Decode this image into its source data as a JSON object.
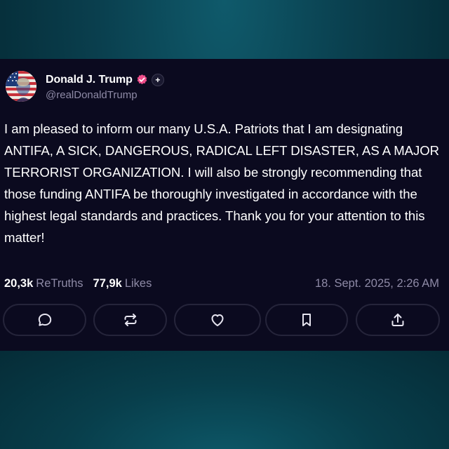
{
  "post": {
    "author": {
      "display_name": "Donald J. Trump",
      "handle": "@realDonaldTrump",
      "plus_label": "+"
    },
    "text": "I am pleased to inform our many U.S.A. Patriots that I am designating ANTIFA, A SICK, DANGEROUS, RADICAL LEFT DISASTER, AS A MAJOR TERRORIST ORGANIZATION. I will also be strongly recommending that those funding ANTIFA be thoroughly investigated in accordance with the highest legal standards and practices. Thank you for your attention to this matter!",
    "stats": {
      "retruths_count": "20,3k",
      "retruths_label": "ReTruths",
      "likes_count": "77,9k",
      "likes_label": "Likes"
    },
    "timestamp": "18. Sept. 2025, 2:26 AM",
    "actions": [
      {
        "name": "reply",
        "icon": "speech-bubble-icon"
      },
      {
        "name": "retruth",
        "icon": "repost-arrows-icon"
      },
      {
        "name": "like",
        "icon": "heart-icon"
      },
      {
        "name": "bookmark",
        "icon": "bookmark-icon"
      },
      {
        "name": "share",
        "icon": "share-upload-icon"
      }
    ]
  },
  "colors": {
    "card_background": "#0b0a1f",
    "text_primary": "#ffffff",
    "text_secondary": "#8e8aa6",
    "verified_badge": "#ee4d8a",
    "button_border": "#25243a",
    "page_background": "#0a3f4e"
  }
}
